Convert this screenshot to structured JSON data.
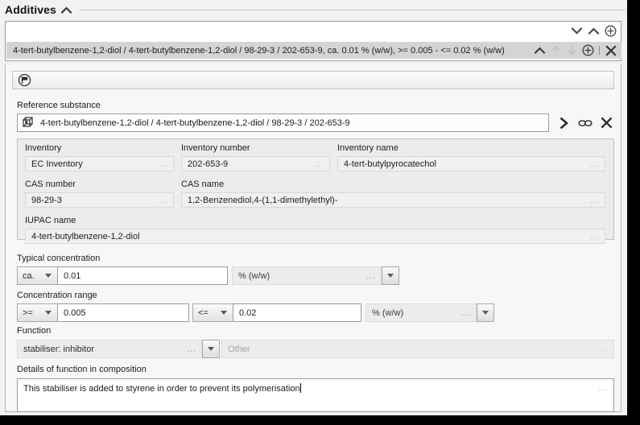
{
  "section": {
    "title": "Additives",
    "collapse_icon": "chevron-up-icon"
  },
  "list_panel": {
    "toolbar": [
      {
        "name": "chevron-down-icon",
        "label": "Next",
        "state": "enabled"
      },
      {
        "name": "chevron-up-icon",
        "label": "Previous",
        "state": "enabled"
      },
      {
        "name": "plus-circle-icon",
        "label": "Add",
        "state": "enabled"
      }
    ],
    "selected_row": {
      "text": "4-tert-butylbenzene-1,2-diol / 4-tert-butylbenzene-1,2-diol / 98-29-3 / 202-653-9, ca. 0.01 % (w/w), >= 0.005 - <= 0.02 % (w/w)",
      "tools": [
        {
          "name": "chevron-up-icon",
          "label": "Collapse entry",
          "state": "enabled"
        },
        {
          "name": "arrow-up-icon",
          "label": "Move up",
          "state": "disabled"
        },
        {
          "name": "arrow-down-icon",
          "label": "Move down",
          "state": "disabled"
        },
        {
          "name": "plus-circle-icon",
          "label": "Add entry",
          "state": "enabled"
        },
        {
          "name": "close-icon",
          "label": "Delete entry",
          "state": "enabled"
        }
      ]
    }
  },
  "form": {
    "mini_toolbar": {
      "icon": "flag-circle-icon",
      "label": "Flag"
    },
    "reference_substance": {
      "label": "Reference substance",
      "icon": "molecule-icon",
      "value": "4-tert-butylbenzene-1,2-diol / 4-tert-butylbenzene-1,2-diol / 98-29-3 / 202-653-9",
      "actions": [
        {
          "name": "arrow-right-icon",
          "label": "Open"
        },
        {
          "name": "link-icon",
          "label": "Link"
        },
        {
          "name": "close-icon",
          "label": "Clear"
        }
      ]
    },
    "inventory": {
      "fields": [
        {
          "label": "Inventory",
          "value": "EC Inventory",
          "dots": "..."
        },
        {
          "label": "Inventory number",
          "value": "202-653-9",
          "dots": "..."
        },
        {
          "label": "Inventory name",
          "value": "4-tert-butylpyrocatechol",
          "dots": "..."
        },
        {
          "label": "CAS number",
          "value": "98-29-3",
          "dots": "..."
        },
        {
          "label": "CAS name",
          "value": "1,2-Benzenediol,4-(1,1-dimethylethyl)-",
          "dots": "..."
        },
        {
          "label": "IUPAC name",
          "value": "4-tert-butylbenzene-1,2-diol",
          "dots": "..."
        }
      ]
    },
    "typical_concentration": {
      "label": "Typical concentration",
      "qualifier": "ca.",
      "value": "0.01",
      "unit": "% (w/w)",
      "unit_dots": "..."
    },
    "concentration_range": {
      "label": "Concentration range",
      "lower_qualifier": ">=",
      "lower_value": "0.005",
      "upper_qualifier": "<=",
      "upper_value": "0.02",
      "unit": "% (w/w)",
      "unit_dots": "..."
    },
    "function": {
      "label": "Function",
      "value": "stabiliser: inhibitor",
      "dots": "...",
      "other_placeholder": "Other",
      "other_dots": "..."
    },
    "details": {
      "label": "Details of function in composition",
      "value": "This stabiliser is added to styrene in order to prevent its polymerisation",
      "dots": "..."
    }
  },
  "colors": {
    "panel_bg": "#f7f7f7",
    "selection": "#d4d4d4",
    "field_readonly": "#f0f0f0",
    "border": "#9c9c9c"
  }
}
